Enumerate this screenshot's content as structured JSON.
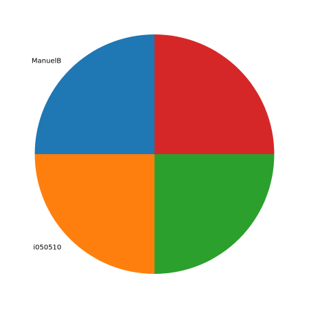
{
  "chart_data": {
    "type": "pie",
    "title": "",
    "start_angle_deg": 90,
    "direction": "counterclockwise",
    "legend": "none",
    "slices": [
      {
        "label": "ManuelB",
        "value": 25,
        "color": "#1f77b4"
      },
      {
        "label": "i050510",
        "value": 25,
        "color": "#ff7f0e"
      },
      {
        "label": "",
        "value": 25,
        "color": "#2ca02c"
      },
      {
        "label": "",
        "value": 25,
        "color": "#d62728"
      }
    ]
  }
}
